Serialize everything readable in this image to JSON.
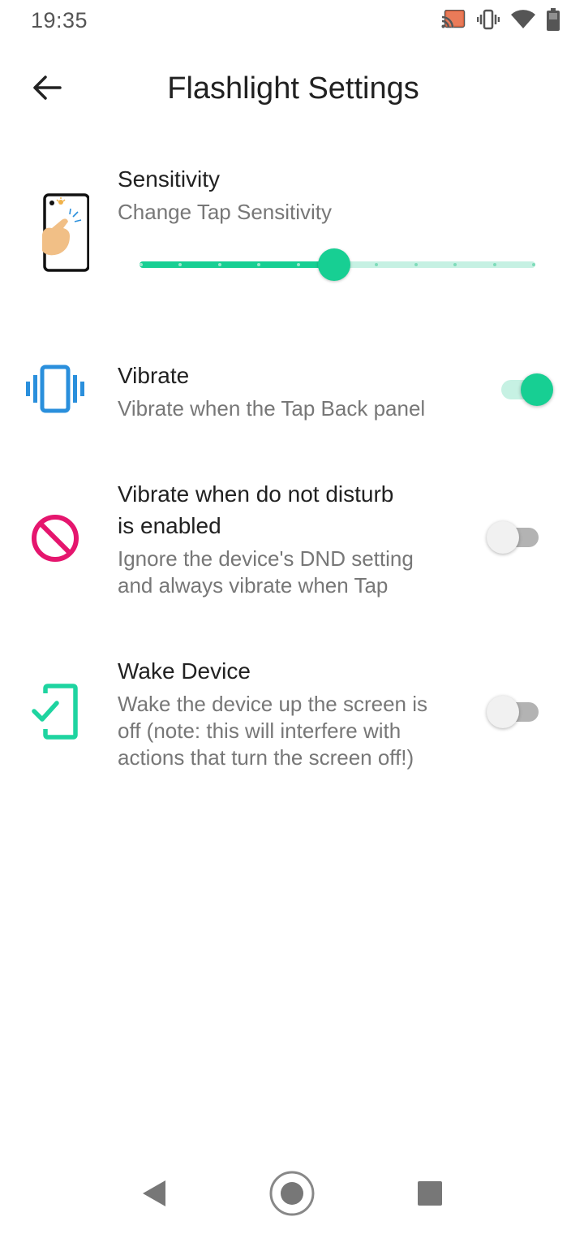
{
  "status_bar": {
    "time": "19:35",
    "icons": [
      "cast-icon",
      "vibrate-mode-icon",
      "wifi-icon",
      "battery-icon"
    ]
  },
  "header": {
    "title": "Flashlight Settings",
    "back_icon": "arrow-back-icon"
  },
  "settings": {
    "sensitivity": {
      "title": "Sensitivity",
      "subtitle": "Change Tap Sensitivity",
      "icon": "phone-tap-icon",
      "slider_value": 5,
      "slider_max": 10
    },
    "vibrate": {
      "title": "Vibrate",
      "subtitle": "Vibrate when the Tap Back panel",
      "icon": "vibration-icon",
      "enabled": true
    },
    "dnd": {
      "title_line1": "Vibrate when do not disturb",
      "title_line2": "is enabled",
      "subtitle_line1": "Ignore the device's DND setting",
      "subtitle_line2": "and always vibrate when Tap",
      "icon": "block-icon",
      "enabled": false
    },
    "wake": {
      "title": "Wake Device",
      "subtitle_line1": "Wake the device up the screen is",
      "subtitle_line2": "off (note: this will interfere with",
      "subtitle_line3": "actions that turn the screen off!)",
      "icon": "phone-check-icon",
      "enabled": false
    }
  },
  "colors": {
    "accent": "#17cf93",
    "accent_light": "#c6f1e3",
    "vibrate_icon": "#2a8fdc",
    "block_icon": "#e5166e",
    "wake_icon": "#1ed4a0",
    "switch_off_track": "#b3b3b3",
    "switch_off_thumb": "#f1f1f1"
  },
  "nav_bar": {
    "back": "nav-back-icon",
    "home": "nav-home-icon",
    "recents": "nav-recents-icon"
  }
}
